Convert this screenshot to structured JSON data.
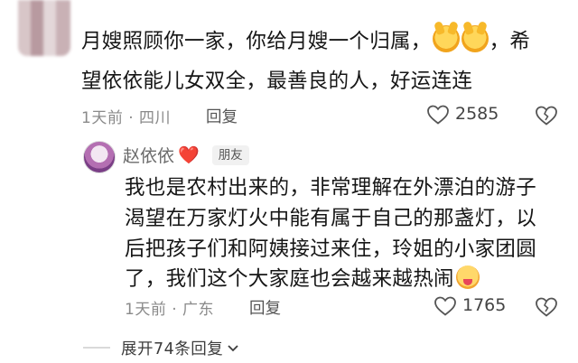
{
  "comment": {
    "text_line1_a": "月嫂照顾你一家，你给月嫂一个归属，",
    "text_line1_b": "，希",
    "text_line2": "望依依能儿女双全，最善良的人，好运连连",
    "emoji": "clapping-hands",
    "time_location": "1天前 · 四川",
    "reply_label": "回复",
    "like_count": "2585"
  },
  "reply": {
    "author": "赵依依",
    "author_emoji": "❤️",
    "badge": "朋友",
    "line1": "我也是农村出来的，非常理解在外漂泊的游子",
    "line2": "渴望在万家灯火中能有属于自己的那盏灯，以",
    "line3": "后把孩子们和阿姨接过来住，玲姐的小家团圆",
    "line4": "了，我们这个大家庭也会越来越热闹",
    "emoji": "smiling-face",
    "time_location": "1天前 · 广东",
    "reply_label": "回复",
    "like_count": "1765"
  },
  "expand": {
    "label": "展开74条回复"
  },
  "colors": {
    "text": "#161616",
    "meta": "#8a8a8a",
    "heart_red": "#e02c3b"
  }
}
